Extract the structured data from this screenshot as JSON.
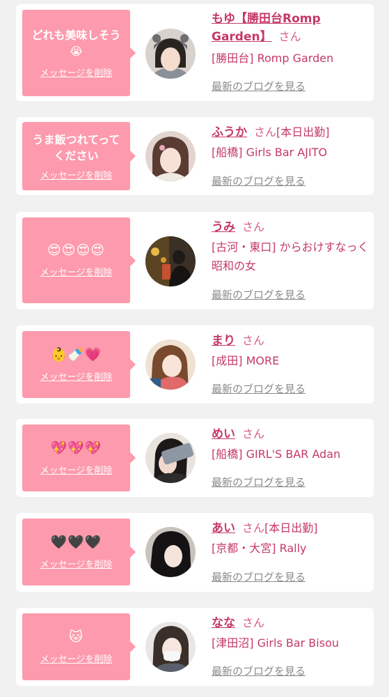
{
  "colors": {
    "page_bg": "#f1f1f1",
    "bubble_bg": "#fd9aad",
    "name_color": "#c5386a",
    "link_gray": "#8a8a8a"
  },
  "cards": [
    {
      "message": "どれも美味しそう😭",
      "delete_label": "メッセージを削除",
      "name": "もゆ【勝田台Romp Garden】",
      "honorific": "さん",
      "status": "",
      "shop": "[勝田台] Romp Garden",
      "blog_label": "最新のブログを見る"
    },
    {
      "message": "うま飯つれてってください",
      "delete_label": "メッセージを削除",
      "name": "ふうか",
      "honorific": "さん",
      "status": "[本日出勤]",
      "shop": "[船橋] Girls Bar AJITO",
      "blog_label": "最新のブログを見る"
    },
    {
      "message": "😍😍😍😍",
      "delete_label": "メッセージを削除",
      "name": "うみ",
      "honorific": "さん",
      "status": "",
      "shop": "[古河・東口] からおけすなっく 昭和の女",
      "blog_label": "最新のブログを見る"
    },
    {
      "message": "👶🍼💗",
      "delete_label": "メッセージを削除",
      "name": "まり",
      "honorific": "さん",
      "status": "",
      "shop": "[成田] MORE",
      "blog_label": "最新のブログを見る"
    },
    {
      "message": "💖💖💖",
      "delete_label": "メッセージを削除",
      "name": "めい",
      "honorific": "さん",
      "status": "",
      "shop": "[船橋] GIRL'S BAR Adan",
      "blog_label": "最新のブログを見る"
    },
    {
      "message": "🖤🖤🖤",
      "delete_label": "メッセージを削除",
      "name": "あい",
      "honorific": "さん",
      "status": "[本日出勤]",
      "shop": "[京都・大宮] Rally",
      "blog_label": "最新のブログを見る"
    },
    {
      "message": "🐱",
      "delete_label": "メッセージを削除",
      "name": "なな",
      "honorific": "さん",
      "status": "",
      "shop": "[津田沼] Girls Bar Bisou",
      "blog_label": "最新のブログを見る"
    }
  ]
}
